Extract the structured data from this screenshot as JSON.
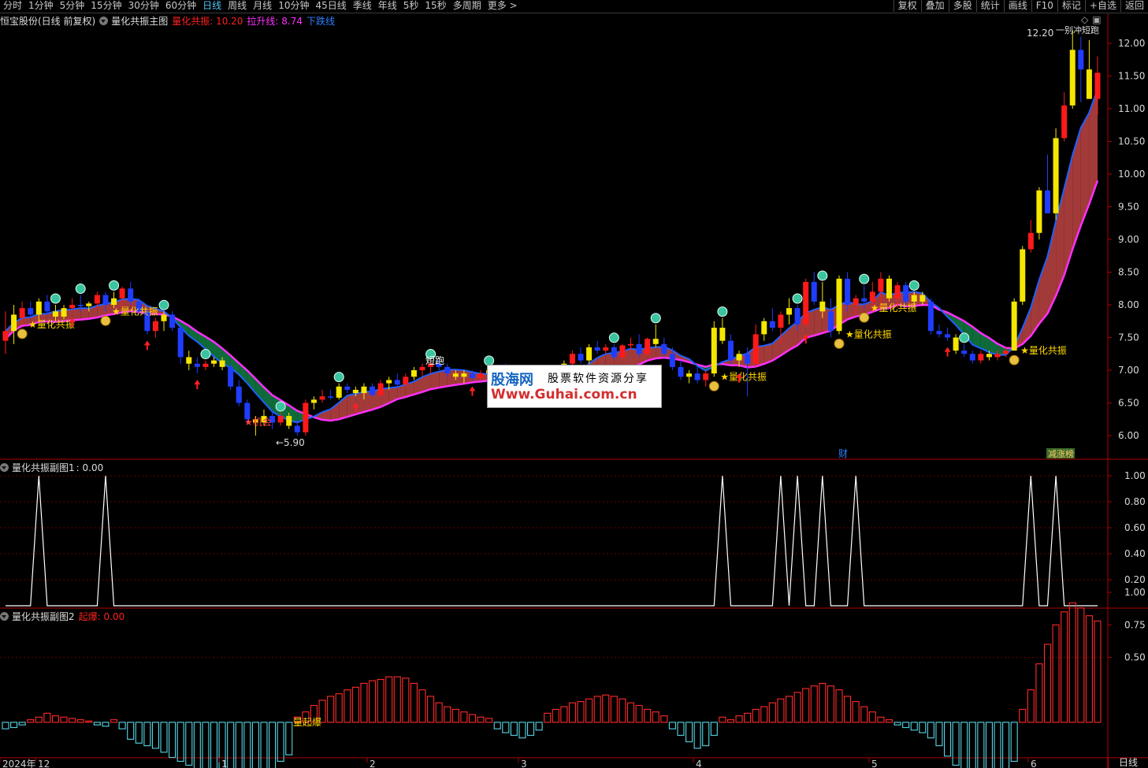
{
  "toolbar": {
    "periods": [
      "分时",
      "1分钟",
      "5分钟",
      "15分钟",
      "30分钟",
      "60分钟",
      "日线",
      "周线",
      "月线",
      "10分钟",
      "45日线",
      "季线",
      "年线",
      "5秒",
      "15秒",
      "多周期",
      "更多 >"
    ],
    "active_period": "日线",
    "right_buttons": [
      "复权",
      "叠加",
      "多股",
      "统计",
      "画线",
      "F10",
      "标记",
      "+自选",
      "返回"
    ]
  },
  "main_panel": {
    "title": "恒宝股份(日线 前复权)",
    "indicator_name": "量化共振主图",
    "legend": [
      {
        "text": "量化共振: 10.20",
        "color": "#ff2020"
      },
      {
        "text": "拉升线: 8.74",
        "color": "#ff30ff"
      },
      {
        "text": "下跌线",
        "color": "#3080ff"
      }
    ],
    "window_icons": [
      "◇",
      "▣"
    ]
  },
  "sub1": {
    "title": "量化共振副图1",
    "value_text": ": 0.00"
  },
  "sub2": {
    "title": "量化共振副图2",
    "legend_text": "起爆: 0.00"
  },
  "watermark": {
    "line1_brand": "股海网",
    "line1_text": "股票软件资源分享",
    "line2": "Www.Guhai.com.cn"
  },
  "bottom_right_button": "日线",
  "chart_data": {
    "type": "candlestick",
    "title": "恒宝股份(日线 前复权)",
    "y_ticks": [
      "12.00",
      "11.50",
      "11.00",
      "10.50",
      "10.00",
      "9.50",
      "9.00",
      "8.50",
      "8.00",
      "7.50",
      "7.00",
      "6.50",
      "6.00"
    ],
    "x_ticks": [
      "2024年",
      "12",
      "1",
      "2",
      "3",
      "4",
      "5",
      "6"
    ],
    "annotations": {
      "high_label": "12.20",
      "high_suffix": "一别冲短跑",
      "low_label": "5.90",
      "signal_label": "量化共振",
      "short_run_label": "短跑",
      "chance_label": "机会",
      "finance_tag": "财",
      "limit_tag": "减涨榜",
      "burst_label": "量起爆"
    },
    "candles": [
      {
        "o": 7.45,
        "h": 7.9,
        "l": 7.25,
        "c": 7.6
      },
      {
        "o": 7.6,
        "h": 8.0,
        "l": 7.4,
        "c": 7.85
      },
      {
        "o": 7.8,
        "h": 8.05,
        "l": 7.7,
        "c": 7.95
      },
      {
        "o": 7.95,
        "h": 8.05,
        "l": 7.8,
        "c": 7.85
      },
      {
        "o": 7.85,
        "h": 8.1,
        "l": 7.75,
        "c": 8.05
      },
      {
        "o": 8.05,
        "h": 8.15,
        "l": 7.85,
        "c": 7.9
      },
      {
        "o": 7.9,
        "h": 8.0,
        "l": 7.75,
        "c": 7.82
      },
      {
        "o": 7.82,
        "h": 8.0,
        "l": 7.78,
        "c": 7.95
      },
      {
        "o": 7.95,
        "h": 8.1,
        "l": 7.9,
        "c": 8.0
      },
      {
        "o": 8.0,
        "h": 8.15,
        "l": 7.9,
        "c": 7.98
      },
      {
        "o": 7.98,
        "h": 8.05,
        "l": 7.9,
        "c": 8.02
      },
      {
        "o": 8.02,
        "h": 8.2,
        "l": 7.95,
        "c": 8.15
      },
      {
        "o": 8.15,
        "h": 8.2,
        "l": 7.9,
        "c": 8.0
      },
      {
        "o": 8.0,
        "h": 8.2,
        "l": 7.95,
        "c": 8.1
      },
      {
        "o": 8.1,
        "h": 8.28,
        "l": 7.95,
        "c": 8.25
      },
      {
        "o": 8.25,
        "h": 8.35,
        "l": 8.0,
        "c": 8.05
      },
      {
        "o": 8.05,
        "h": 8.1,
        "l": 7.85,
        "c": 7.9
      },
      {
        "o": 7.9,
        "h": 7.95,
        "l": 7.55,
        "c": 7.6
      },
      {
        "o": 7.6,
        "h": 7.8,
        "l": 7.5,
        "c": 7.75
      },
      {
        "o": 7.75,
        "h": 7.9,
        "l": 7.6,
        "c": 7.85
      },
      {
        "o": 7.85,
        "h": 7.9,
        "l": 7.6,
        "c": 7.65
      },
      {
        "o": 7.65,
        "h": 7.7,
        "l": 7.1,
        "c": 7.2
      },
      {
        "o": 7.2,
        "h": 7.3,
        "l": 7.0,
        "c": 7.1
      },
      {
        "o": 7.1,
        "h": 7.2,
        "l": 6.95,
        "c": 7.05
      },
      {
        "o": 7.05,
        "h": 7.15,
        "l": 7.0,
        "c": 7.1
      },
      {
        "o": 7.1,
        "h": 7.2,
        "l": 7.05,
        "c": 7.15
      },
      {
        "o": 7.15,
        "h": 7.2,
        "l": 7.0,
        "c": 7.05
      },
      {
        "o": 7.05,
        "h": 7.1,
        "l": 6.7,
        "c": 6.75
      },
      {
        "o": 6.75,
        "h": 6.85,
        "l": 6.45,
        "c": 6.5
      },
      {
        "o": 6.5,
        "h": 6.55,
        "l": 6.2,
        "c": 6.25
      },
      {
        "o": 6.25,
        "h": 6.3,
        "l": 6.0,
        "c": 6.2
      },
      {
        "o": 6.2,
        "h": 6.4,
        "l": 6.15,
        "c": 6.3
      },
      {
        "o": 6.3,
        "h": 6.4,
        "l": 6.1,
        "c": 6.2
      },
      {
        "o": 6.2,
        "h": 6.35,
        "l": 6.15,
        "c": 6.3
      },
      {
        "o": 6.3,
        "h": 6.35,
        "l": 6.1,
        "c": 6.15
      },
      {
        "o": 6.15,
        "h": 6.25,
        "l": 6.0,
        "c": 6.05
      },
      {
        "o": 6.05,
        "h": 6.55,
        "l": 6.0,
        "c": 6.5
      },
      {
        "o": 6.5,
        "h": 6.6,
        "l": 6.4,
        "c": 6.55
      },
      {
        "o": 6.55,
        "h": 6.7,
        "l": 6.5,
        "c": 6.6
      },
      {
        "o": 6.6,
        "h": 6.7,
        "l": 6.55,
        "c": 6.58
      },
      {
        "o": 6.58,
        "h": 6.8,
        "l": 6.55,
        "c": 6.75
      },
      {
        "o": 6.75,
        "h": 6.8,
        "l": 6.65,
        "c": 6.7
      },
      {
        "o": 6.7,
        "h": 6.75,
        "l": 6.6,
        "c": 6.65
      },
      {
        "o": 6.65,
        "h": 6.8,
        "l": 6.55,
        "c": 6.75
      },
      {
        "o": 6.75,
        "h": 6.8,
        "l": 6.6,
        "c": 6.62
      },
      {
        "o": 6.62,
        "h": 6.85,
        "l": 6.6,
        "c": 6.8
      },
      {
        "o": 6.8,
        "h": 6.9,
        "l": 6.7,
        "c": 6.85
      },
      {
        "o": 6.85,
        "h": 6.95,
        "l": 6.75,
        "c": 6.78
      },
      {
        "o": 6.78,
        "h": 6.95,
        "l": 6.75,
        "c": 6.9
      },
      {
        "o": 6.9,
        "h": 7.05,
        "l": 6.85,
        "c": 7.0
      },
      {
        "o": 7.0,
        "h": 7.1,
        "l": 6.9,
        "c": 7.05
      },
      {
        "o": 7.05,
        "h": 7.15,
        "l": 6.95,
        "c": 7.1
      },
      {
        "o": 7.1,
        "h": 7.15,
        "l": 7.0,
        "c": 7.05
      },
      {
        "o": 7.05,
        "h": 7.1,
        "l": 6.9,
        "c": 6.95
      },
      {
        "o": 6.95,
        "h": 7.0,
        "l": 6.85,
        "c": 6.9
      },
      {
        "o": 6.9,
        "h": 7.0,
        "l": 6.8,
        "c": 6.95
      },
      {
        "o": 6.95,
        "h": 7.0,
        "l": 6.85,
        "c": 6.88
      },
      {
        "o": 6.88,
        "h": 7.0,
        "l": 6.85,
        "c": 6.95
      },
      {
        "o": 6.95,
        "h": 7.05,
        "l": 6.9,
        "c": 7.0
      },
      {
        "o": 7.0,
        "h": 7.05,
        "l": 6.95,
        "c": 7.02
      },
      {
        "o": 7.02,
        "h": 7.1,
        "l": 6.95,
        "c": 7.0
      },
      {
        "o": 7.0,
        "h": 7.05,
        "l": 6.9,
        "c": 6.95
      },
      {
        "o": 6.95,
        "h": 7.0,
        "l": 6.85,
        "c": 6.9
      },
      {
        "o": 6.9,
        "h": 7.0,
        "l": 6.8,
        "c": 6.85
      },
      {
        "o": 6.85,
        "h": 6.95,
        "l": 6.45,
        "c": 6.55
      },
      {
        "o": 6.55,
        "h": 6.8,
        "l": 6.5,
        "c": 6.75
      },
      {
        "o": 6.75,
        "h": 7.05,
        "l": 6.7,
        "c": 7.0
      },
      {
        "o": 7.0,
        "h": 7.15,
        "l": 6.95,
        "c": 7.1
      },
      {
        "o": 7.1,
        "h": 7.3,
        "l": 7.0,
        "c": 7.25
      },
      {
        "o": 7.25,
        "h": 7.35,
        "l": 7.1,
        "c": 7.15
      },
      {
        "o": 7.15,
        "h": 7.4,
        "l": 7.1,
        "c": 7.35
      },
      {
        "o": 7.35,
        "h": 7.45,
        "l": 7.25,
        "c": 7.3
      },
      {
        "o": 7.3,
        "h": 7.4,
        "l": 7.25,
        "c": 7.35
      },
      {
        "o": 7.35,
        "h": 7.4,
        "l": 7.15,
        "c": 7.2
      },
      {
        "o": 7.2,
        "h": 7.4,
        "l": 7.15,
        "c": 7.38
      },
      {
        "o": 7.38,
        "h": 7.5,
        "l": 7.3,
        "c": 7.4
      },
      {
        "o": 7.4,
        "h": 7.55,
        "l": 7.2,
        "c": 7.25
      },
      {
        "o": 7.25,
        "h": 7.5,
        "l": 7.2,
        "c": 7.48
      },
      {
        "o": 7.48,
        "h": 7.7,
        "l": 7.35,
        "c": 7.4
      },
      {
        "o": 7.4,
        "h": 7.5,
        "l": 7.2,
        "c": 7.25
      },
      {
        "o": 7.25,
        "h": 7.35,
        "l": 7.0,
        "c": 7.05
      },
      {
        "o": 7.05,
        "h": 7.15,
        "l": 6.85,
        "c": 6.9
      },
      {
        "o": 6.9,
        "h": 7.0,
        "l": 6.8,
        "c": 6.95
      },
      {
        "o": 6.95,
        "h": 7.05,
        "l": 6.8,
        "c": 6.85
      },
      {
        "o": 6.85,
        "h": 7.0,
        "l": 6.75,
        "c": 6.95
      },
      {
        "o": 6.95,
        "h": 7.75,
        "l": 6.9,
        "c": 7.65
      },
      {
        "o": 7.65,
        "h": 7.8,
        "l": 7.4,
        "c": 7.45
      },
      {
        "o": 7.45,
        "h": 7.55,
        "l": 7.1,
        "c": 7.15
      },
      {
        "o": 7.15,
        "h": 7.3,
        "l": 7.05,
        "c": 7.25
      },
      {
        "o": 7.25,
        "h": 7.35,
        "l": 6.6,
        "c": 7.1
      },
      {
        "o": 7.1,
        "h": 7.7,
        "l": 7.05,
        "c": 7.55
      },
      {
        "o": 7.55,
        "h": 7.8,
        "l": 7.45,
        "c": 7.75
      },
      {
        "o": 7.75,
        "h": 7.95,
        "l": 7.6,
        "c": 7.65
      },
      {
        "o": 7.65,
        "h": 7.9,
        "l": 7.4,
        "c": 7.85
      },
      {
        "o": 7.85,
        "h": 8.1,
        "l": 7.7,
        "c": 7.95
      },
      {
        "o": 7.95,
        "h": 8.0,
        "l": 7.6,
        "c": 7.7
      },
      {
        "o": 7.7,
        "h": 8.4,
        "l": 7.65,
        "c": 8.35
      },
      {
        "o": 8.35,
        "h": 8.5,
        "l": 8.0,
        "c": 8.05
      },
      {
        "o": 8.05,
        "h": 8.35,
        "l": 7.8,
        "c": 7.9
      },
      {
        "o": 7.9,
        "h": 8.1,
        "l": 7.5,
        "c": 7.6
      },
      {
        "o": 7.6,
        "h": 8.45,
        "l": 7.55,
        "c": 8.4
      },
      {
        "o": 8.4,
        "h": 8.5,
        "l": 7.9,
        "c": 8.0
      },
      {
        "o": 8.0,
        "h": 8.15,
        "l": 7.85,
        "c": 8.1
      },
      {
        "o": 8.1,
        "h": 8.3,
        "l": 7.95,
        "c": 8.05
      },
      {
        "o": 8.05,
        "h": 8.35,
        "l": 7.9,
        "c": 8.2
      },
      {
        "o": 8.2,
        "h": 8.5,
        "l": 7.95,
        "c": 8.4
      },
      {
        "o": 8.4,
        "h": 8.45,
        "l": 8.05,
        "c": 8.1
      },
      {
        "o": 8.1,
        "h": 8.35,
        "l": 7.95,
        "c": 8.3
      },
      {
        "o": 8.3,
        "h": 8.35,
        "l": 8.0,
        "c": 8.05
      },
      {
        "o": 8.05,
        "h": 8.2,
        "l": 7.95,
        "c": 8.15
      },
      {
        "o": 8.15,
        "h": 8.2,
        "l": 8.0,
        "c": 8.05
      },
      {
        "o": 8.05,
        "h": 8.1,
        "l": 7.55,
        "c": 7.6
      },
      {
        "o": 7.6,
        "h": 7.7,
        "l": 7.5,
        "c": 7.55
      },
      {
        "o": 7.55,
        "h": 7.65,
        "l": 7.45,
        "c": 7.5
      },
      {
        "o": 7.5,
        "h": 7.55,
        "l": 7.25,
        "c": 7.3
      },
      {
        "o": 7.3,
        "h": 7.4,
        "l": 7.2,
        "c": 7.25
      },
      {
        "o": 7.25,
        "h": 7.3,
        "l": 7.1,
        "c": 7.15
      },
      {
        "o": 7.15,
        "h": 7.3,
        "l": 7.1,
        "c": 7.25
      },
      {
        "o": 7.25,
        "h": 7.3,
        "l": 7.15,
        "c": 7.2
      },
      {
        "o": 7.2,
        "h": 7.3,
        "l": 7.15,
        "c": 7.25
      },
      {
        "o": 7.25,
        "h": 7.35,
        "l": 7.2,
        "c": 7.3
      },
      {
        "o": 7.3,
        "h": 8.1,
        "l": 7.3,
        "c": 8.05
      },
      {
        "o": 8.05,
        "h": 8.9,
        "l": 8.0,
        "c": 8.85
      },
      {
        "o": 8.85,
        "h": 9.3,
        "l": 8.8,
        "c": 9.1
      },
      {
        "o": 9.1,
        "h": 9.8,
        "l": 9.0,
        "c": 9.75
      },
      {
        "o": 9.75,
        "h": 10.3,
        "l": 9.6,
        "c": 9.4
      },
      {
        "o": 9.4,
        "h": 10.7,
        "l": 9.3,
        "c": 10.55
      },
      {
        "o": 10.55,
        "h": 11.25,
        "l": 10.5,
        "c": 11.05
      },
      {
        "o": 11.05,
        "h": 12.2,
        "l": 11.0,
        "c": 11.9
      },
      {
        "o": 11.9,
        "h": 12.1,
        "l": 11.1,
        "c": 11.6
      },
      {
        "o": 11.6,
        "h": 12.05,
        "l": 11.2,
        "c": 11.15
      },
      {
        "o": 11.15,
        "h": 11.8,
        "l": 10.9,
        "c": 11.55
      }
    ],
    "sub1_series": [
      0,
      0,
      0,
      0,
      1,
      0,
      0,
      0,
      0,
      0,
      0,
      0,
      1,
      0,
      0,
      0,
      0,
      0,
      0,
      0,
      0,
      0,
      0,
      0,
      0,
      0,
      0,
      0,
      0,
      0,
      0,
      0,
      0,
      0,
      0,
      0,
      0,
      0,
      0,
      0,
      0,
      0,
      0,
      0,
      0,
      0,
      0,
      0,
      0,
      0,
      0,
      0,
      0,
      0,
      0,
      0,
      0,
      0,
      0,
      0,
      0,
      0,
      0,
      0,
      0,
      0,
      0,
      0,
      0,
      0,
      0,
      0,
      0,
      0,
      0,
      0,
      0,
      0,
      0,
      0,
      0,
      0,
      0,
      0,
      0,
      0,
      1,
      0,
      0,
      0,
      0,
      0,
      0,
      1,
      0,
      1,
      0,
      0,
      1,
      0,
      0,
      0,
      1,
      0,
      0,
      0,
      0,
      0,
      0,
      0,
      0,
      0,
      0,
      0,
      0,
      0,
      0,
      0,
      0,
      0,
      0,
      0,
      0,
      1,
      0,
      0,
      1,
      0,
      0,
      0,
      0,
      0
    ],
    "sub2_series": [
      -0.05,
      -0.04,
      -0.02,
      0.02,
      0.04,
      0.07,
      0.05,
      0.04,
      0.03,
      0.02,
      0.01,
      -0.02,
      -0.03,
      0.02,
      -0.05,
      -0.13,
      -0.16,
      -0.18,
      -0.2,
      -0.23,
      -0.27,
      -0.3,
      -0.33,
      -0.36,
      -0.38,
      -0.41,
      -0.43,
      -0.45,
      -0.46,
      -0.44,
      -0.42,
      -0.4,
      -0.36,
      -0.3,
      -0.25,
      0.04,
      0.08,
      0.13,
      0.17,
      0.2,
      0.22,
      0.25,
      0.27,
      0.3,
      0.32,
      0.33,
      0.35,
      0.35,
      0.34,
      0.3,
      0.25,
      0.2,
      0.15,
      0.12,
      0.1,
      0.08,
      0.06,
      0.04,
      0.03,
      -0.05,
      -0.08,
      -0.1,
      -0.12,
      -0.1,
      -0.06,
      0.07,
      0.1,
      0.12,
      0.15,
      0.16,
      0.18,
      0.2,
      0.21,
      0.2,
      0.18,
      0.15,
      0.13,
      0.1,
      0.08,
      0.05,
      -0.05,
      -0.1,
      -0.15,
      -0.2,
      -0.18,
      -0.1,
      0.04,
      0.02,
      0.05,
      0.07,
      0.1,
      0.12,
      0.15,
      0.18,
      0.2,
      0.23,
      0.26,
      0.28,
      0.3,
      0.28,
      0.25,
      0.2,
      0.16,
      0.12,
      0.08,
      0.04,
      0.02,
      -0.02,
      -0.04,
      -0.06,
      -0.08,
      -0.12,
      -0.18,
      -0.26,
      -0.33,
      -0.38,
      -0.4,
      -0.42,
      -0.43,
      -0.42,
      -0.4,
      -0.3,
      0.1,
      0.25,
      0.45,
      0.6,
      0.75,
      0.85,
      0.92,
      0.88,
      0.82,
      0.78
    ]
  }
}
